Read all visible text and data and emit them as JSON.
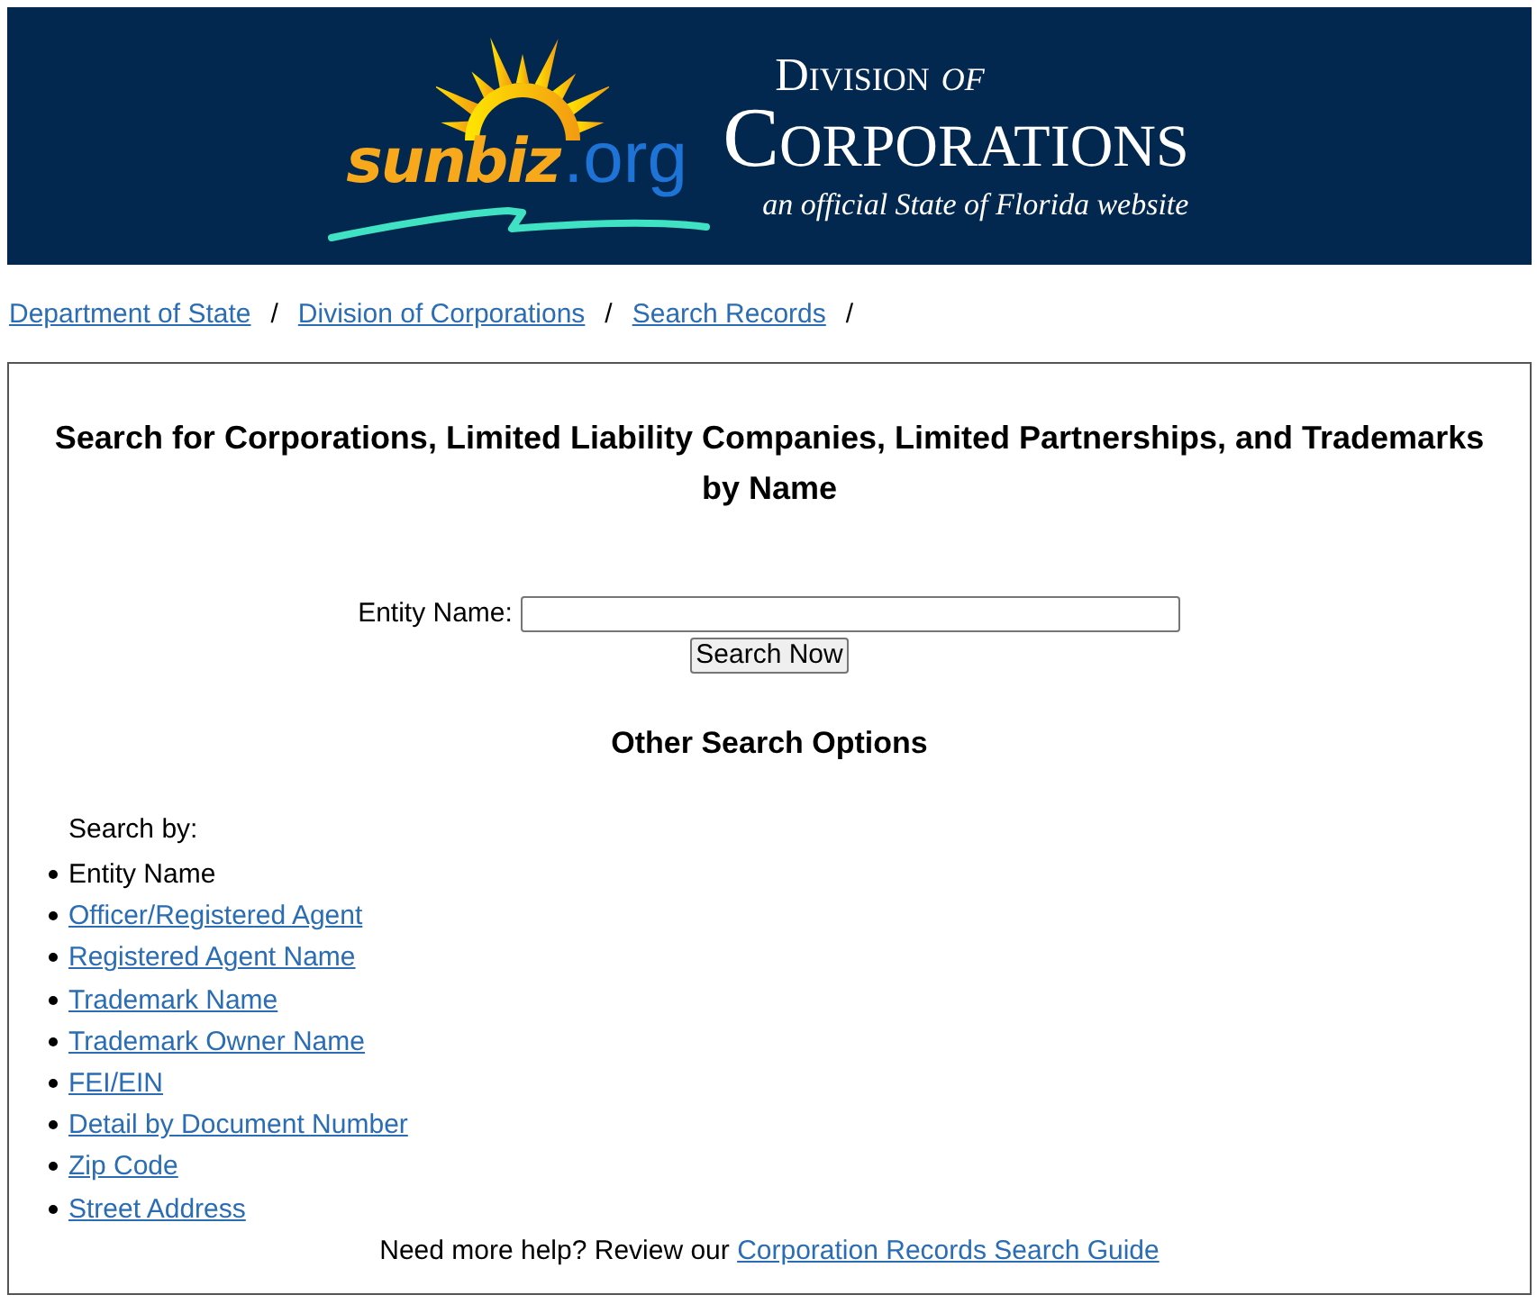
{
  "banner": {
    "logo_word": "sunbiz",
    "logo_suffix": ".org",
    "subtitle": "Division *of*",
    "title": "Corporations",
    "tagline": "an official State of Florida website"
  },
  "breadcrumb": [
    {
      "label": "Department of State",
      "separator": "/"
    },
    {
      "label": "Division of Corporations",
      "separator": "/"
    },
    {
      "label": "Search Records",
      "separator": "/"
    }
  ],
  "search_form": {
    "heading": "Search for Corporations, Limited Liability Companies, Limited Partnerships, and Trademarks by Name",
    "field_label": "Entity Name:",
    "button": "Search Now"
  },
  "other_options": {
    "heading": "Other Search Options",
    "intro": "Search by:",
    "items": [
      {
        "label": "Entity Name",
        "kind": "current"
      },
      {
        "label": "Officer/Registered Agent",
        "kind": "link"
      },
      {
        "label": "Registered Agent Name",
        "kind": "link"
      },
      {
        "label": "Trademark Name",
        "kind": "link"
      },
      {
        "label": "Trademark Owner Name",
        "kind": "link"
      },
      {
        "label": "FEI/EIN",
        "kind": "link"
      },
      {
        "label": "Detail by Document Number",
        "kind": "link"
      },
      {
        "label": "Zip Code",
        "kind": "link"
      },
      {
        "label": "Street Address",
        "kind": "link"
      }
    ]
  },
  "help": {
    "text": "Need more help? Review our",
    "link": "Corporation Records Search Guide"
  }
}
